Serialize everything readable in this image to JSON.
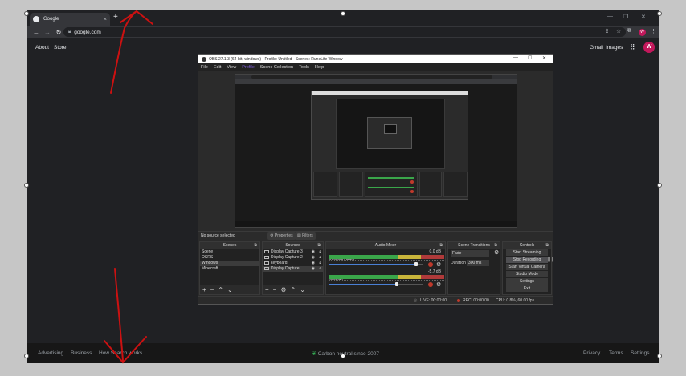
{
  "browser": {
    "tab_title": "Google",
    "new_tab": "+",
    "tab_close": "×",
    "url": "google.com",
    "avatar_letter": "W"
  },
  "google": {
    "top_left": [
      "About",
      "Store"
    ],
    "top_right": [
      "Gmail",
      "Images"
    ],
    "avatar_letter": "W",
    "footer_left": [
      "Advertising",
      "Business",
      "How Search works"
    ],
    "footer_center": "Carbon neutral since 2007",
    "footer_right": [
      "Privacy",
      "Terms",
      "Settings"
    ]
  },
  "obs": {
    "title": "OBS 27.1.3 (64-bit, windows) - Profile: Untitled - Scenes: RuneLite Window",
    "menu": [
      "File",
      "Edit",
      "View",
      "Profile",
      "Scene Collection",
      "Tools",
      "Help"
    ],
    "no_source": "No source selected",
    "properties_tab": "Properties",
    "filters_tab": "Filters",
    "scenes": {
      "title": "Scenes",
      "items": [
        "Scene",
        "OSRS",
        "Windows",
        "Minecraft"
      ],
      "selected_index": 2
    },
    "sources": {
      "title": "Sources",
      "items": [
        "Display Capture 3",
        "Display Capture 2",
        "keyboard",
        "Display Capture"
      ]
    },
    "mixer": {
      "title": "Audio Mixer",
      "channels": [
        {
          "name": "Desktop Audio",
          "db": "0.0 dB",
          "volume": 0.92
        },
        {
          "name": "Mic/Aux",
          "db": "-5.7 dB",
          "volume": 0.72
        }
      ]
    },
    "transitions": {
      "title": "Scene Transitions",
      "type": "Fade",
      "duration_label": "Duration",
      "duration_value": "300 ms"
    },
    "controls": {
      "title": "Controls",
      "buttons": [
        "Start Streaming",
        "Stop Recording",
        "Start Virtual Camera",
        "Studio Mode",
        "Settings",
        "Exit"
      ]
    },
    "status": {
      "live": "LIVE: 00:00:00",
      "rec": "REC: 00:00:00",
      "cpu": "CPU: 0.8%, 60.00 fps"
    }
  },
  "colors": {
    "annotation": "#cc1111",
    "obs_accent": "#7c5cd6",
    "recording": "#c0392b"
  }
}
